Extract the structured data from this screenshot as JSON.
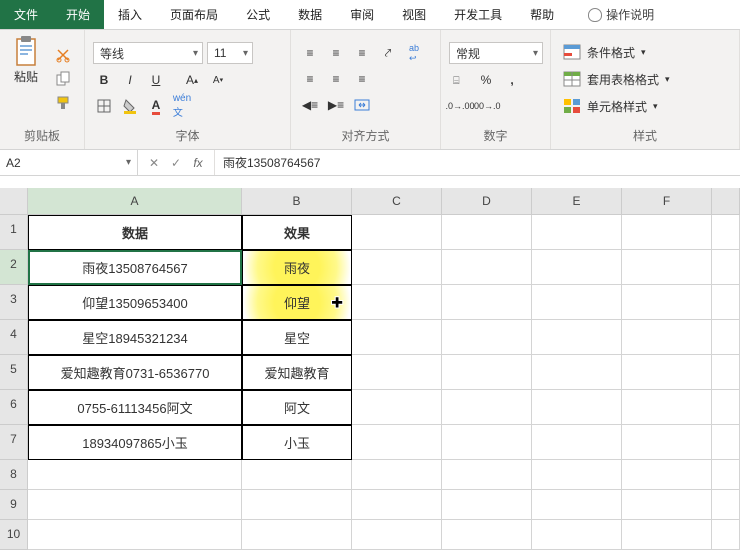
{
  "tabs": {
    "file": "文件",
    "home": "开始",
    "insert": "插入",
    "layout": "页面布局",
    "formulas": "公式",
    "data": "数据",
    "review": "审阅",
    "view": "视图",
    "dev": "开发工具",
    "help": "帮助",
    "tell": "操作说明"
  },
  "ribbon": {
    "clipboard": {
      "label": "剪贴板",
      "paste": "粘贴"
    },
    "font": {
      "label": "字体",
      "name": "等线",
      "size": "11"
    },
    "align": {
      "label": "对齐方式"
    },
    "number": {
      "label": "数字",
      "format": "常规"
    },
    "styles": {
      "label": "样式",
      "cond": "条件格式",
      "table": "套用表格格式",
      "cell": "单元格样式"
    }
  },
  "namebox": "A2",
  "formula": "雨夜13508764567",
  "colHeaders": [
    "A",
    "B",
    "C",
    "D",
    "E",
    "F"
  ],
  "rowHeaders": [
    "1",
    "2",
    "3",
    "4",
    "5",
    "6",
    "7",
    "8",
    "9",
    "10"
  ],
  "table": {
    "h1": "数据",
    "h2": "效果",
    "r": [
      {
        "a": "雨夜13508764567",
        "b": "雨夜"
      },
      {
        "a": "仰望13509653400",
        "b": "仰望"
      },
      {
        "a": "星空18945321234",
        "b": "星空"
      },
      {
        "a": "爱知趣教育0731-6536770",
        "b": "爱知趣教育"
      },
      {
        "a": "0755-61113456阿文",
        "b": "阿文"
      },
      {
        "a": "18934097865小玉",
        "b": "小玉"
      }
    ]
  }
}
